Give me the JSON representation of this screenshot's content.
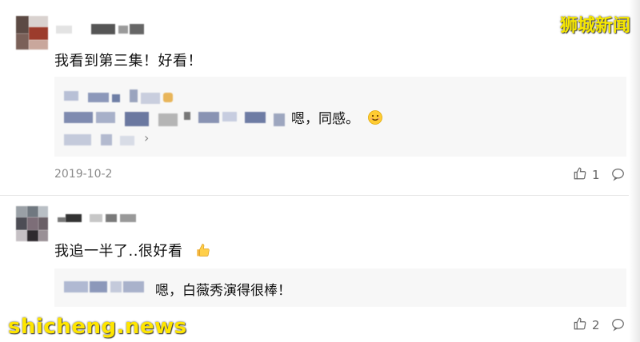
{
  "watermark": {
    "cn": "狮城新闻",
    "en": "shicheng.news"
  },
  "comments": [
    {
      "text": "我看到第三集！好看！",
      "reply": {
        "text": "嗯，同感。",
        "chevron": "›"
      },
      "date": "2019-10-2",
      "likes": "1",
      "icons": [
        "thumbs-up-icon",
        "comment-icon",
        "smile-emoji-icon"
      ]
    },
    {
      "text": "我追一半了..很好看",
      "reply": {
        "text": "嗯，白薇秀演得很棒！"
      },
      "likes": "2",
      "icons": [
        "thumbs-up-icon",
        "comment-icon",
        "thumbs-up-emoji-icon"
      ]
    }
  ],
  "colors": {
    "reply_bg": "#f7f7f7",
    "muted": "#8a8a8a",
    "watermark": "#f6e700"
  }
}
